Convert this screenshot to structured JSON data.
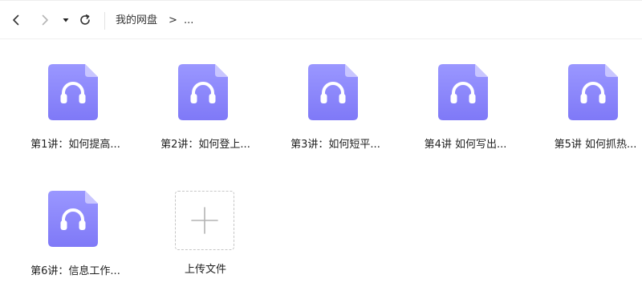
{
  "toolbar": {
    "back_icon": "chevron-left-icon",
    "forward_icon": "chevron-right-icon",
    "dropdown_icon": "caret-down-icon",
    "refresh_icon": "refresh-icon",
    "breadcrumb_root": "我的网盘",
    "breadcrumb_sep": ">",
    "breadcrumb_more": "..."
  },
  "files": [
    {
      "name": "第1讲：如何提高...",
      "icon": "audio-file-icon"
    },
    {
      "name": "第2讲：如何登上...",
      "icon": "audio-file-icon"
    },
    {
      "name": "第3讲：如何短平...",
      "icon": "audio-file-icon"
    },
    {
      "name": "第4讲 如何写出...",
      "icon": "audio-file-icon"
    },
    {
      "name": "第5讲 如何抓热...",
      "icon": "audio-file-icon"
    },
    {
      "name": "第6讲：信息工作...",
      "icon": "audio-file-icon"
    }
  ],
  "upload": {
    "label": "上传文件",
    "icon": "plus-icon"
  },
  "colors": {
    "file_icon_top": "#9a97ff",
    "file_icon_bottom": "#7f79f7",
    "file_fold": "#c9c6ff"
  }
}
